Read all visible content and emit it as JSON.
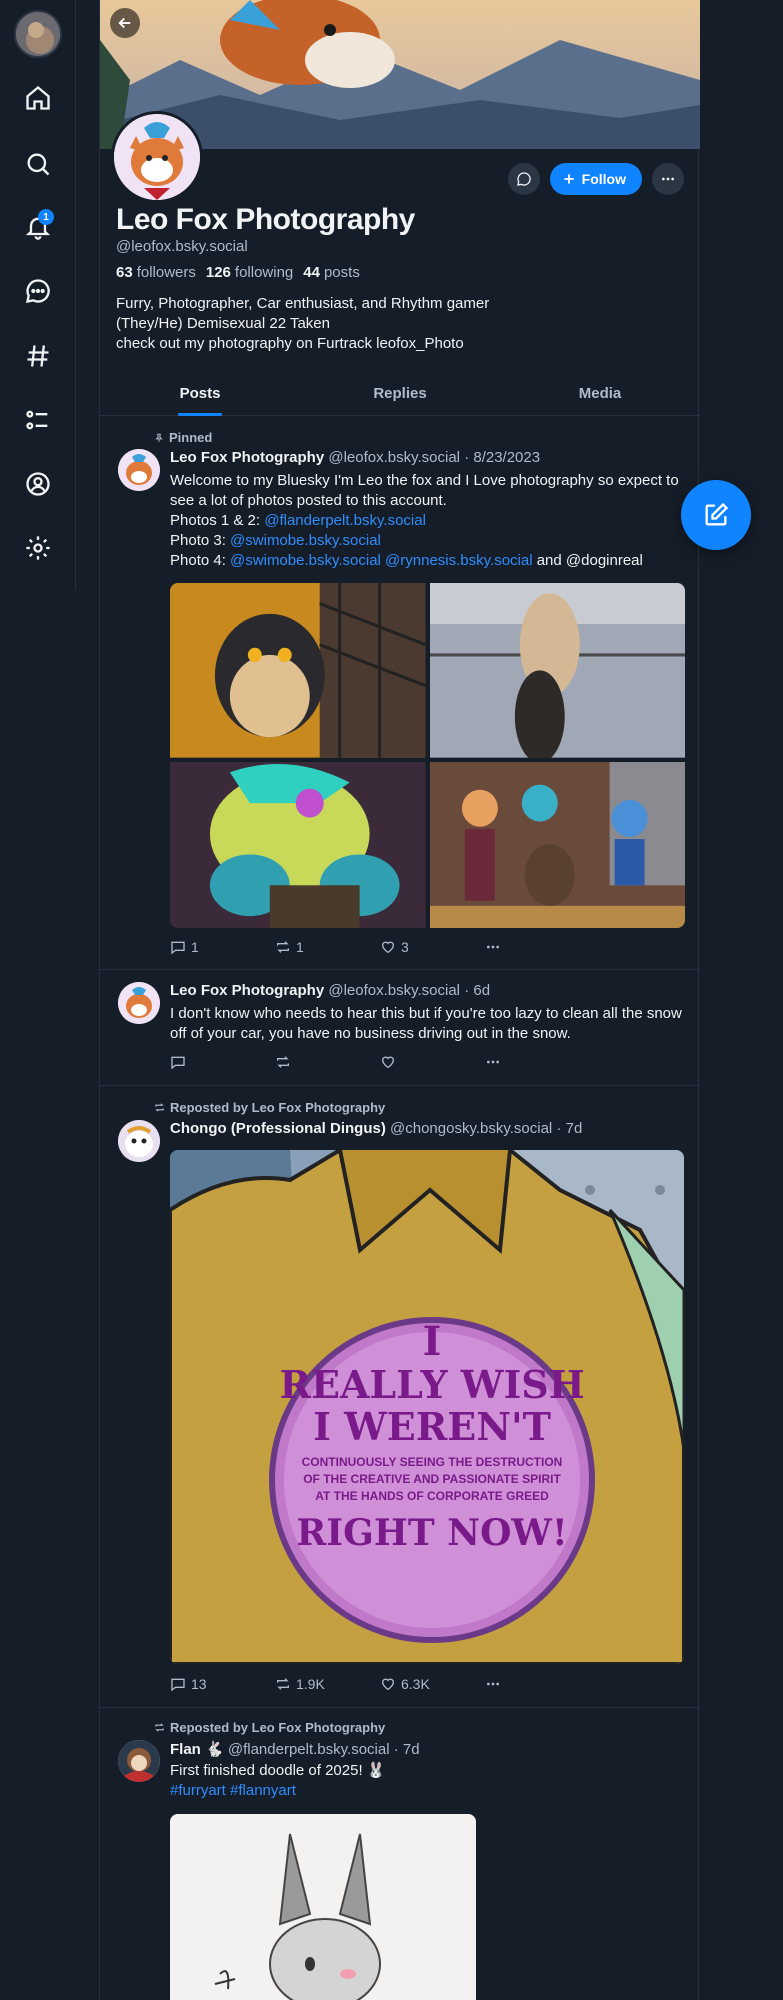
{
  "colors": {
    "accent": "#1083fe",
    "bg": "#151d28",
    "muted": "#aebbc9",
    "link": "#2f8dfd"
  },
  "sidebar": {
    "items": [
      {
        "name": "home",
        "icon": "home-icon"
      },
      {
        "name": "search",
        "icon": "search-icon"
      },
      {
        "name": "notifications",
        "icon": "bell-icon",
        "badge": "1"
      },
      {
        "name": "chat",
        "icon": "chat-icon"
      },
      {
        "name": "feeds",
        "icon": "hashtag-icon"
      },
      {
        "name": "lists",
        "icon": "list-icon"
      },
      {
        "name": "profile",
        "icon": "user-circle-icon"
      },
      {
        "name": "settings",
        "icon": "gear-icon"
      }
    ]
  },
  "profile": {
    "display_name": "Leo Fox Photography",
    "handle": "@leofox.bsky.social",
    "followers_count": "63",
    "followers_label": "followers",
    "following_count": "126",
    "following_label": "following",
    "posts_count": "44",
    "posts_label": "posts",
    "bio": [
      "Furry, Photographer, Car enthusiast, and Rhythm gamer",
      "(They/He) Demisexual 22 Taken",
      "check out my photography on Furtrack leofox_Photo"
    ],
    "follow_label": "Follow"
  },
  "tabs": [
    "Posts",
    "Replies",
    "Media"
  ],
  "posts": [
    {
      "context": "Pinned",
      "author": "Leo Fox Photography",
      "handle": "@leofox.bsky.social",
      "time": "· 8/23/2023",
      "line1": "Welcome to my Bluesky I'm Leo the fox and I Love photography so expect to see a lot of photos posted to this account.",
      "photo12_label": "Photos 1 & 2: ",
      "photo12_link": "@flanderpelt.bsky.social",
      "photo3_label": "Photo 3: ",
      "photo3_link": "@swimobe.bsky.social",
      "photo4_label": "Photo 4: ",
      "photo4_link1": "@swimobe.bsky.social",
      "photo4_link2": "@rynnesis.bsky.social",
      "photo4_and": " and @doginreal",
      "replies": "1",
      "reposts": "1",
      "likes": "3"
    },
    {
      "author": "Leo Fox Photography",
      "handle": "@leofox.bsky.social",
      "time": "· 6d",
      "text": "I don't know who needs to hear this but if you're too lazy to clean all the snow off of your car, you have no business driving out in the snow."
    },
    {
      "context": "Reposted by Leo Fox Photography",
      "author": "Chongo (Professional Dingus)",
      "handle": "@chongosky.bsky.social",
      "time": "· 7d",
      "image_text": {
        "line1": "I",
        "line2": "REALLY WISH",
        "line3": "I WEREN'T",
        "small1": "CONTINUOUSLY SEEING THE DESTRUCTION",
        "small2": "OF THE CREATIVE AND PASSIONATE SPIRIT",
        "small3": "AT THE HANDS OF CORPORATE GREED",
        "line4": "RIGHT NOW!"
      },
      "replies": "13",
      "reposts": "1.9K",
      "likes": "6.3K"
    },
    {
      "context": "Reposted by Leo Fox Photography",
      "author": "Flan 🐇",
      "handle": "@flanderpelt.bsky.social",
      "time": "· 7d",
      "text": "First finished doodle of 2025! 🐰",
      "tags": "#furryart #flannyart"
    }
  ]
}
